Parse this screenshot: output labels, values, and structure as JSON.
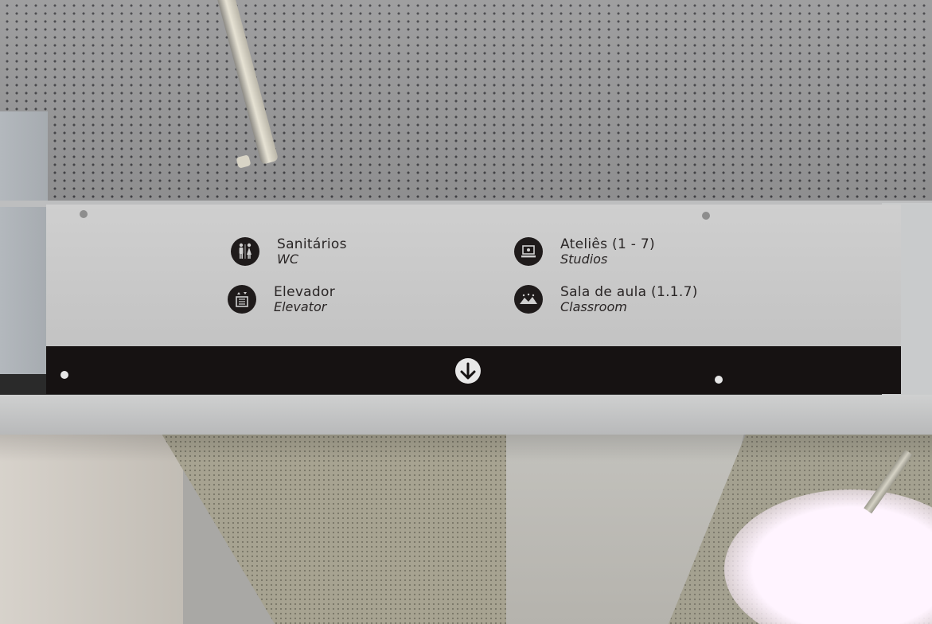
{
  "sign": {
    "entries": [
      {
        "icon": "restroom-icon",
        "label": "Sanitários",
        "translation": "WC"
      },
      {
        "icon": "elevator-icon",
        "label": "Elevador",
        "translation": "Elevator"
      },
      {
        "icon": "studio-icon",
        "label": "Ateliês (1 - 7)",
        "translation": "Studios"
      },
      {
        "icon": "classroom-icon",
        "label": "Sala de aula (1.1.7)",
        "translation": "Classroom"
      }
    ],
    "direction_icon": "arrow-down-icon",
    "colors": {
      "panel": "#c9c9c9",
      "band": "#161212",
      "text": "#2a2626"
    }
  }
}
